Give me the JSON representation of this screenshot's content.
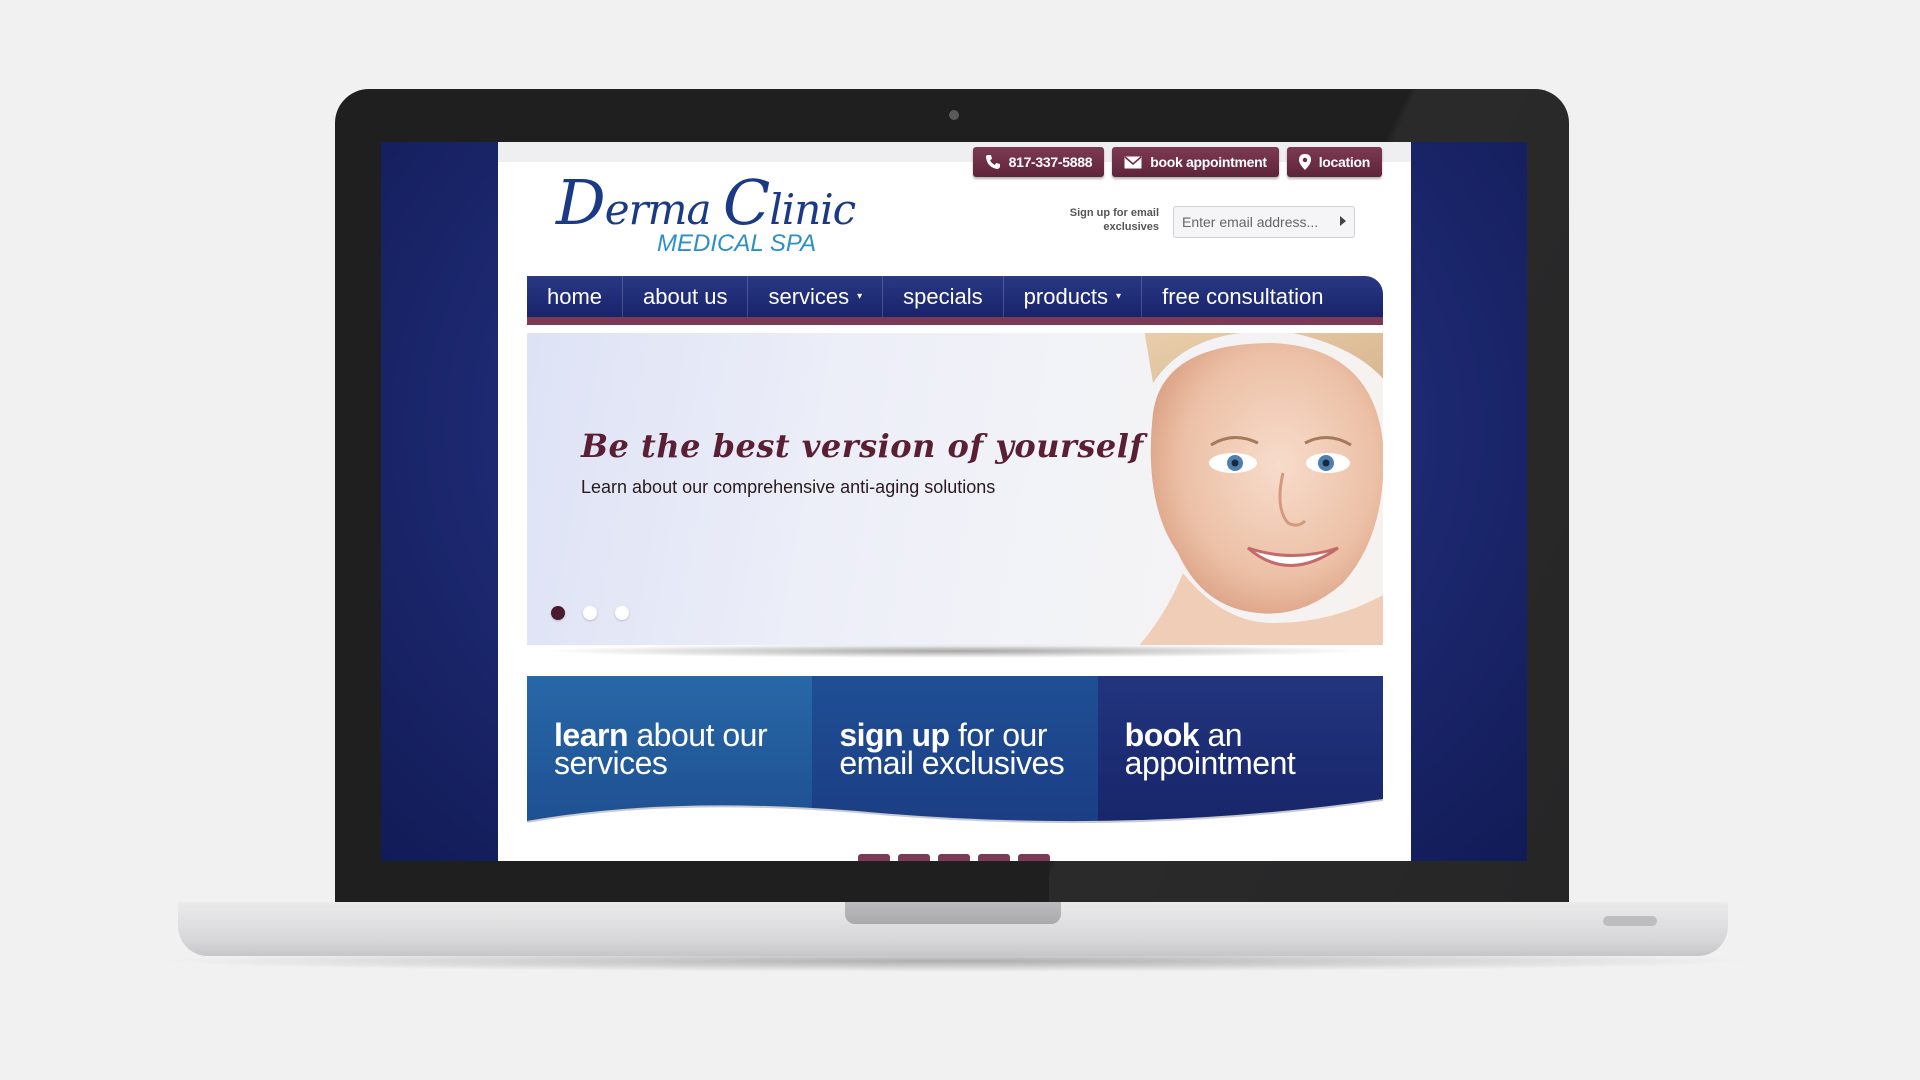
{
  "header": {
    "phone_label": "817-337-5888",
    "book_label": "book appointment",
    "location_label": "location"
  },
  "logo": {
    "main_initial_d": "D",
    "main_rest_1": "erma ",
    "main_initial_c": "C",
    "main_rest_2": "linic",
    "sub": "MEDICAL SPA"
  },
  "signup": {
    "label": "Sign up for email exclusives",
    "placeholder": "Enter email address..."
  },
  "nav": {
    "items": [
      {
        "label": "home"
      },
      {
        "label": "about us"
      },
      {
        "label": "services"
      },
      {
        "label": "specials"
      },
      {
        "label": "products"
      },
      {
        "label": "free consultation"
      }
    ]
  },
  "hero": {
    "title": "Be the best version of yourself",
    "subtitle": "Learn about our comprehensive anti-aging solutions"
  },
  "cta": {
    "tiles": [
      {
        "bold": "learn",
        "rest_1": " about our",
        "line_2": "services"
      },
      {
        "bold": "sign up",
        "rest_1": " for our",
        "line_2": "email exclusives"
      },
      {
        "bold": "book",
        "rest_1": " an",
        "line_2": "appointment"
      }
    ]
  },
  "colors": {
    "brand_plum": "#7b3a56",
    "nav_navy": "#1f2b74",
    "logo_blue": "#1a3a86",
    "logo_sub_blue": "#2d8fc8"
  },
  "icons": [
    "phone-icon",
    "envelope-icon",
    "map-pin-icon",
    "chevron-right-icon",
    "caret-down-icon"
  ]
}
